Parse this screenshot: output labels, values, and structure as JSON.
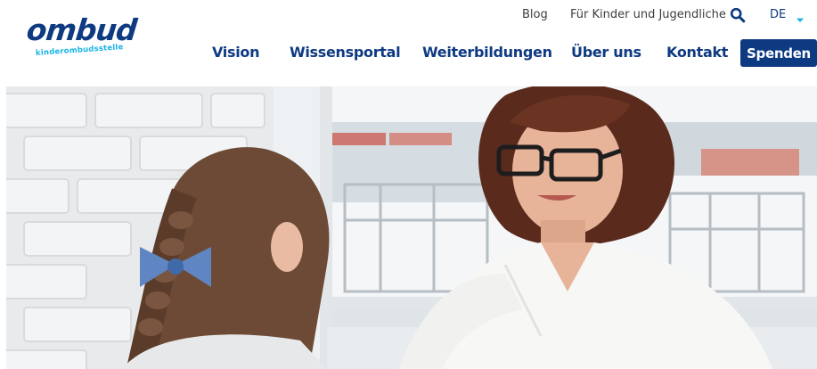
{
  "header": {
    "logo": {
      "wordmark": "ombud",
      "tagline": "kinderombudsstelle"
    },
    "utility_nav": {
      "blog": "Blog",
      "kids": "Für Kinder und Jugendliche",
      "search_icon": "search-icon",
      "language": "DE",
      "language_icon": "caret-down-icon"
    },
    "main_nav": {
      "items": [
        {
          "label": "Vision"
        },
        {
          "label": "Wissensportal"
        },
        {
          "label": "Weiterbildungen"
        },
        {
          "label": "Über uns"
        },
        {
          "label": "Kontakt"
        }
      ],
      "donate": "Spenden"
    }
  },
  "colors": {
    "brand_navy": "#0e3a82",
    "brand_cyan": "#1ab3e5",
    "utility_text": "#3e3e3e"
  },
  "hero": {
    "image": "photo-girl-with-woman-teacher"
  }
}
